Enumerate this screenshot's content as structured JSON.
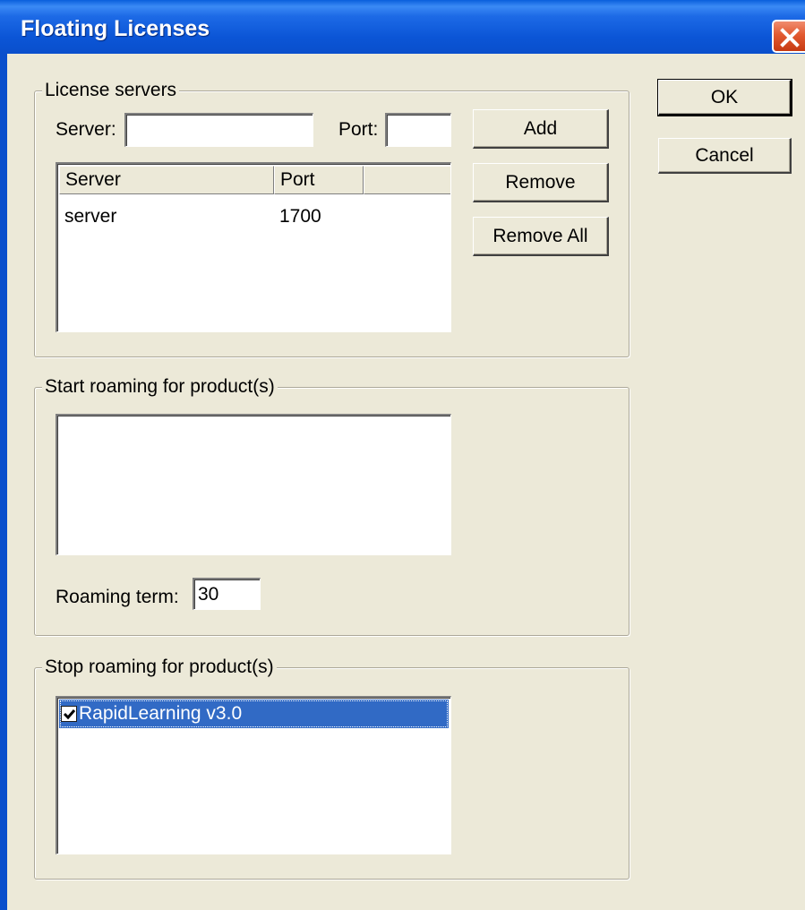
{
  "window": {
    "title": "Floating Licenses"
  },
  "buttons": {
    "ok": "OK",
    "cancel": "Cancel",
    "add": "Add",
    "remove": "Remove",
    "remove_all": "Remove All"
  },
  "license_servers": {
    "group_title": "License servers",
    "server_label": "Server:",
    "server_value": "",
    "port_label": "Port:",
    "port_value": "",
    "columns": [
      "Server",
      "Port"
    ],
    "rows": [
      {
        "server": "server",
        "port": "1700"
      }
    ]
  },
  "start_roaming": {
    "group_title": "Start roaming for product(s)",
    "items": [],
    "term_label": "Roaming term:",
    "term_value": "30"
  },
  "stop_roaming": {
    "group_title": "Stop roaming for product(s)",
    "items": [
      {
        "label": "RapidLearning v3.0",
        "checked": true,
        "selected": true
      }
    ]
  },
  "icons": {
    "close": "close-icon",
    "checkmark": "checkmark-icon"
  },
  "colors": {
    "titlebar": "#0a55d6",
    "selection": "#316ac5",
    "dialog_bg": "#ece9d8",
    "close_button": "#e25a31"
  }
}
